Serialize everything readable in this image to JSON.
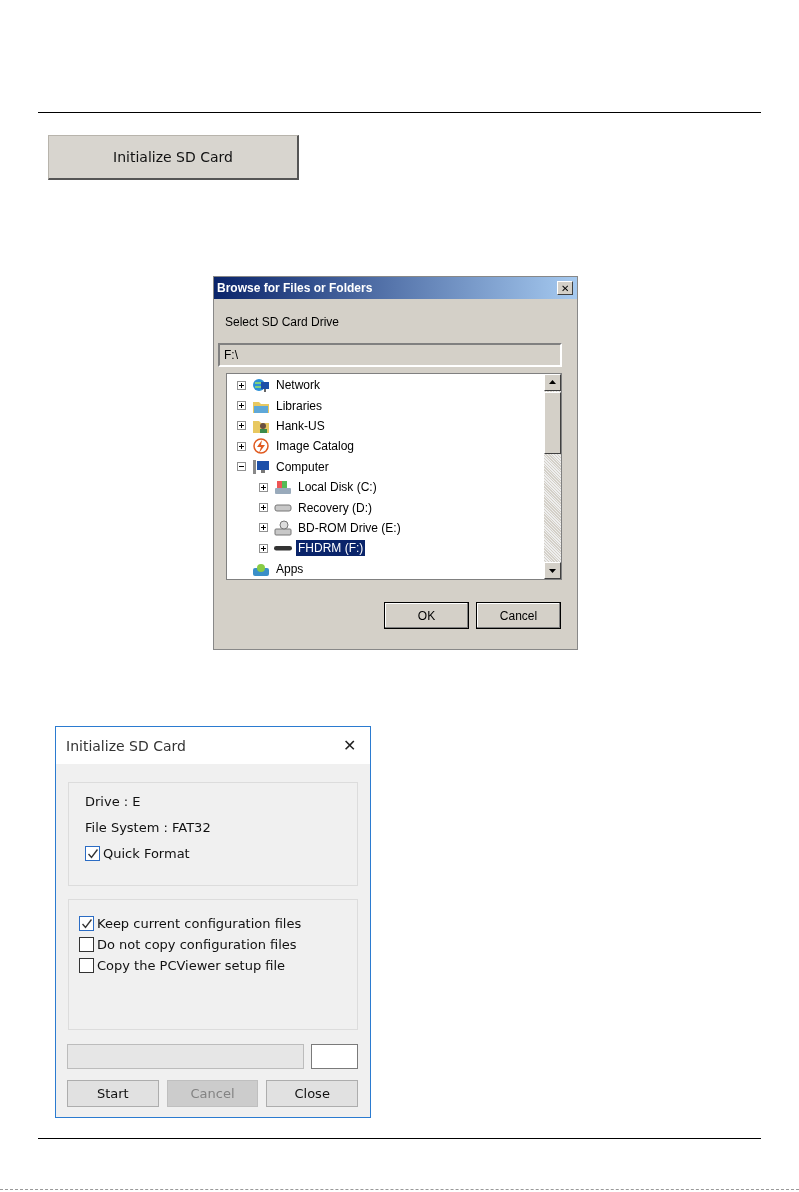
{
  "init_button": {
    "label": "Initialize SD Card"
  },
  "browse_dialog": {
    "title": "Browse for Files or Folders",
    "close": "✕",
    "prompt": "Select SD Card Drive",
    "path": "F:\\",
    "tree": [
      {
        "label": "Network",
        "kind": "node",
        "expanded": false,
        "selected": false
      },
      {
        "label": "Libraries",
        "kind": "node",
        "expanded": false,
        "selected": false
      },
      {
        "label": "Hank-US",
        "kind": "node",
        "expanded": false,
        "selected": false
      },
      {
        "label": "Image Catalog",
        "kind": "node",
        "expanded": false,
        "selected": false
      },
      {
        "label": "Computer",
        "kind": "node",
        "expanded": true,
        "selected": false,
        "children": [
          {
            "label": "Local Disk (C:)",
            "kind": "node",
            "expanded": false,
            "selected": false
          },
          {
            "label": "Recovery (D:)",
            "kind": "node",
            "expanded": false,
            "selected": false
          },
          {
            "label": "BD-ROM Drive (E:)",
            "kind": "node",
            "expanded": false,
            "selected": false
          },
          {
            "label": "FHDRM (F:)",
            "kind": "node",
            "expanded": false,
            "selected": true
          }
        ]
      },
      {
        "label": "Apps",
        "kind": "leaf",
        "selected": false
      }
    ],
    "buttons": [
      {
        "label": "OK",
        "disabled": false
      },
      {
        "label": "Cancel",
        "disabled": false
      }
    ]
  },
  "init_dialog": {
    "title": "Initialize SD Card",
    "close": "✕",
    "info": [
      "Drive : E",
      "File System : FAT32"
    ],
    "quick_format": {
      "label": "Quick Format",
      "checked": true
    },
    "options": [
      {
        "label": "Keep current configuration files",
        "checked": true
      },
      {
        "label": "Do not copy configuration files",
        "checked": false
      },
      {
        "label": "Copy the PCViewer setup file",
        "checked": false
      }
    ],
    "buttons": [
      {
        "label": "Start",
        "disabled": false
      },
      {
        "label": "Cancel",
        "disabled": true
      },
      {
        "label": "Close",
        "disabled": false
      }
    ]
  }
}
